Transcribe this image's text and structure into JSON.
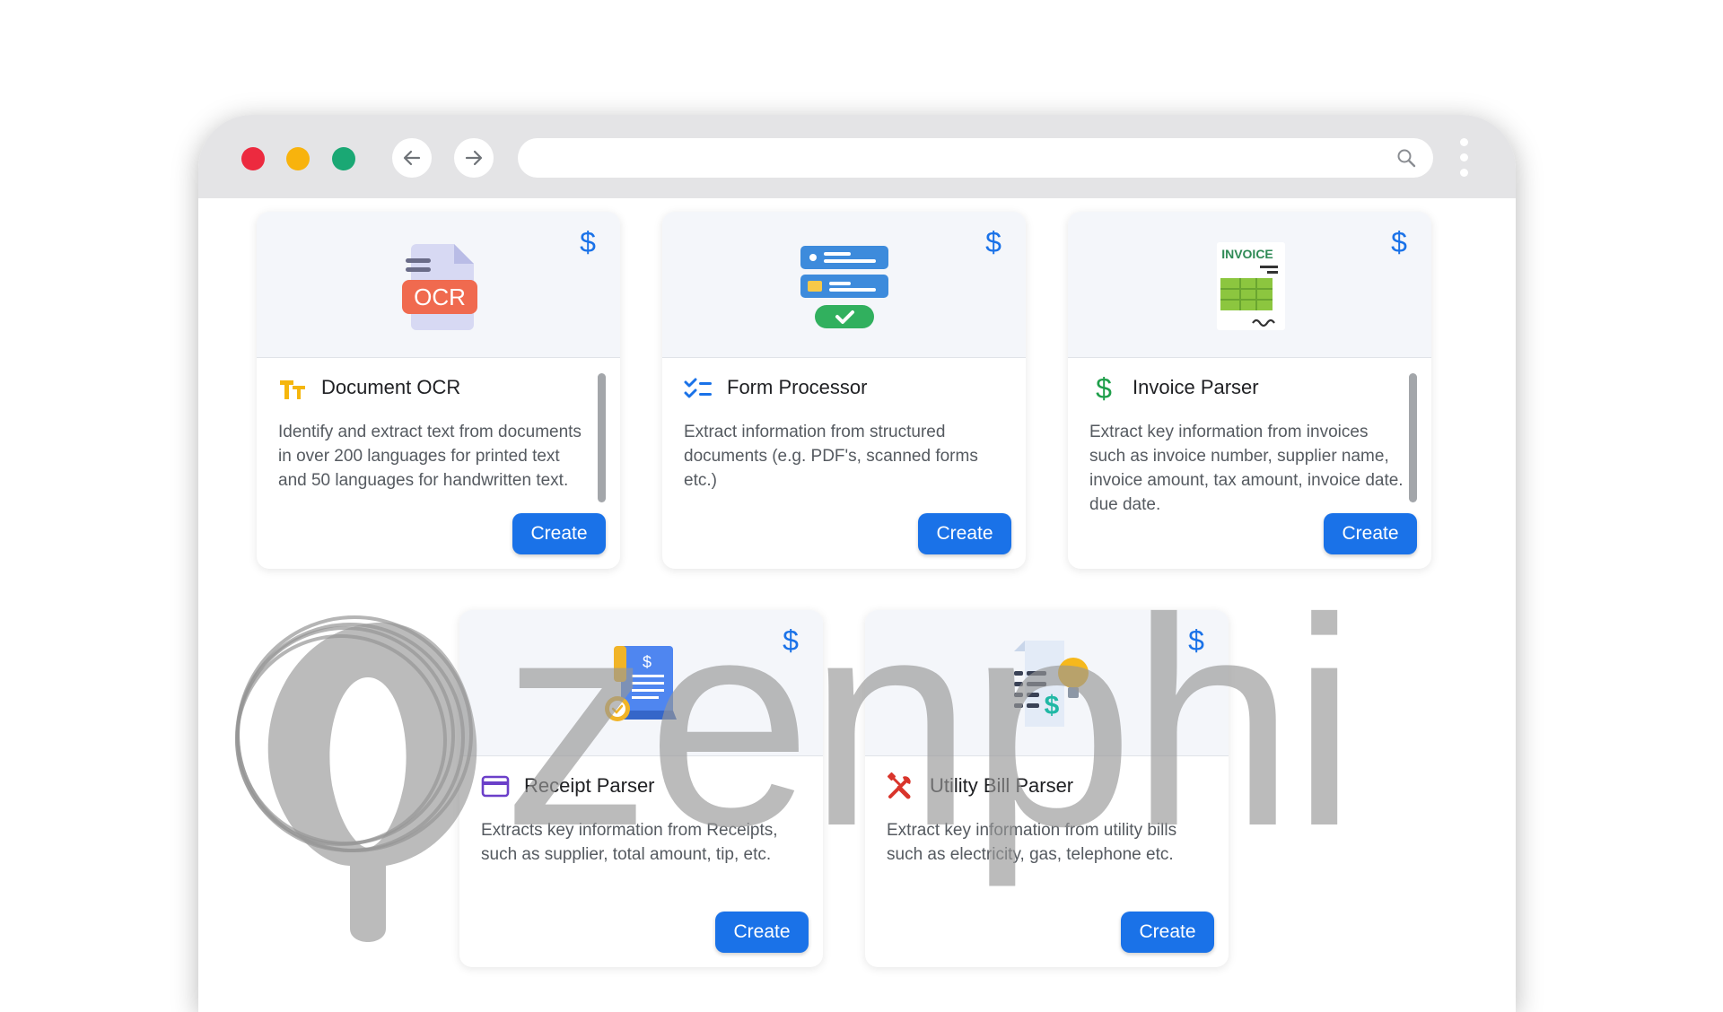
{
  "cards": [
    {
      "title": "Document OCR",
      "description": "Identify and extract text from documents in over 200 languages for printed text and 50 languages for handwritten text.",
      "button": "Create",
      "illustration_text": "OCR",
      "title_icon": "text-format-icon",
      "price_icon": "dollar-icon"
    },
    {
      "title": "Form Processor",
      "description": "Extract information from structured documents (e.g. PDF's, scanned forms etc.)",
      "button": "Create",
      "title_icon": "checklist-icon",
      "price_icon": "dollar-icon"
    },
    {
      "title": "Invoice Parser",
      "description": "Extract key information from invoices such as invoice number, supplier name, invoice amount, tax amount, invoice date. due date.",
      "button": "Create",
      "illustration_text": "INVOICE",
      "title_icon": "dollar-icon",
      "price_icon": "dollar-icon"
    },
    {
      "title": "Receipt Parser",
      "description": "Extracts key information from Receipts, such as supplier, total amount, tip, etc.",
      "button": "Create",
      "title_icon": "credit-card-icon",
      "price_icon": "dollar-icon"
    },
    {
      "title": "Utility Bill Parser",
      "description": "Extract key information from utility bills such as electricity, gas, telephone etc.",
      "button": "Create",
      "title_icon": "tools-icon",
      "price_icon": "dollar-icon"
    }
  ],
  "watermark": {
    "text": "zenphi"
  },
  "colors": {
    "accent": "#1a72e8",
    "price": "#1a72e8",
    "close_dot": "#ec2a3f",
    "minimize_dot": "#f8b30d",
    "maximize_dot": "#1aa874"
  }
}
